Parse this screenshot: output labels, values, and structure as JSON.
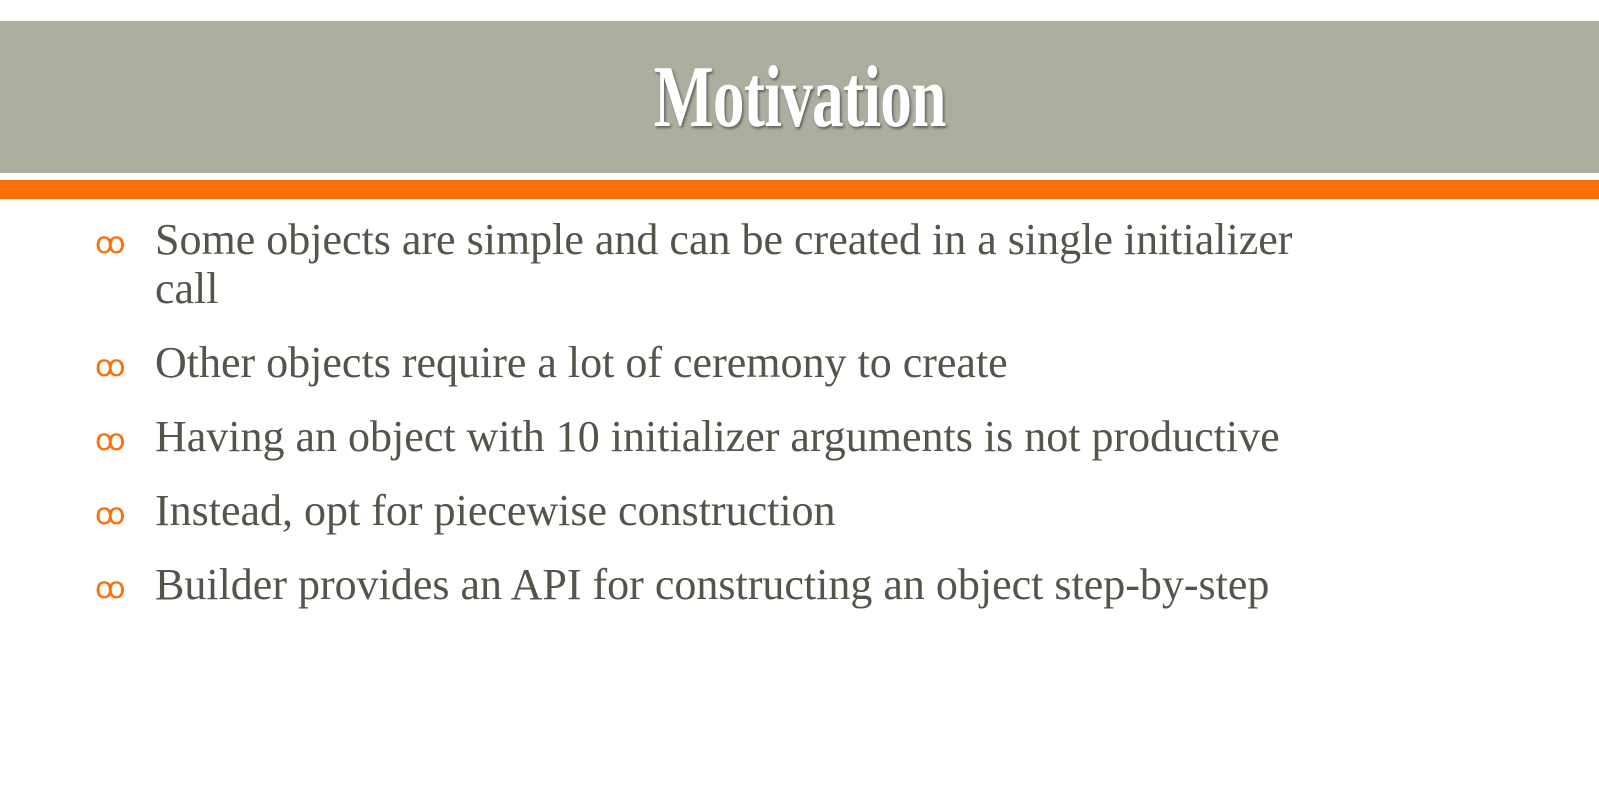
{
  "slide": {
    "title": "Motivation",
    "colors": {
      "header_band": "#aaaf9f",
      "accent": "#fd6f08",
      "text": "#55534a"
    },
    "bullet_icon": "ornamental-swash-bullet",
    "bullets": [
      "Some objects are simple and can be created in a single initializer call",
      "Other objects require a lot of ceremony to create",
      "Having an object with 10 initializer arguments is not productive",
      "Instead, opt for piecewise construction",
      "Builder provides an API for constructing an object step-by-step"
    ]
  }
}
